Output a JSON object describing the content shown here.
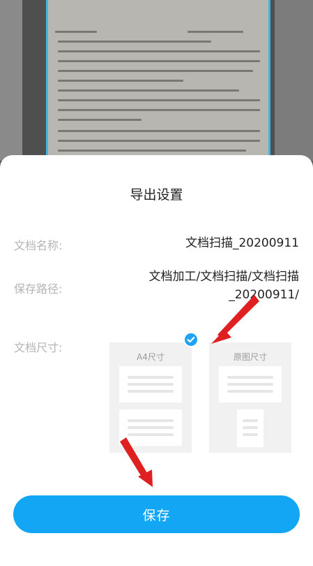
{
  "dialog": {
    "title": "导出设置",
    "name_label": "文档名称:",
    "name_value": "文档扫描_20200911",
    "path_label": "保存路径:",
    "path_value_line1": "文档加工/文档扫描/文档扫描",
    "path_value_line2": "_20200911/",
    "size_label": "文档尺寸:",
    "options": [
      {
        "label": "A4尺寸",
        "selected": true
      },
      {
        "label": "原图尺寸",
        "selected": false
      }
    ],
    "save_label": "保存"
  },
  "colors": {
    "accent": "#12a6f4",
    "annotation_arrow": "#e02020"
  },
  "icons": {
    "selected_check": "check-circle-icon"
  }
}
